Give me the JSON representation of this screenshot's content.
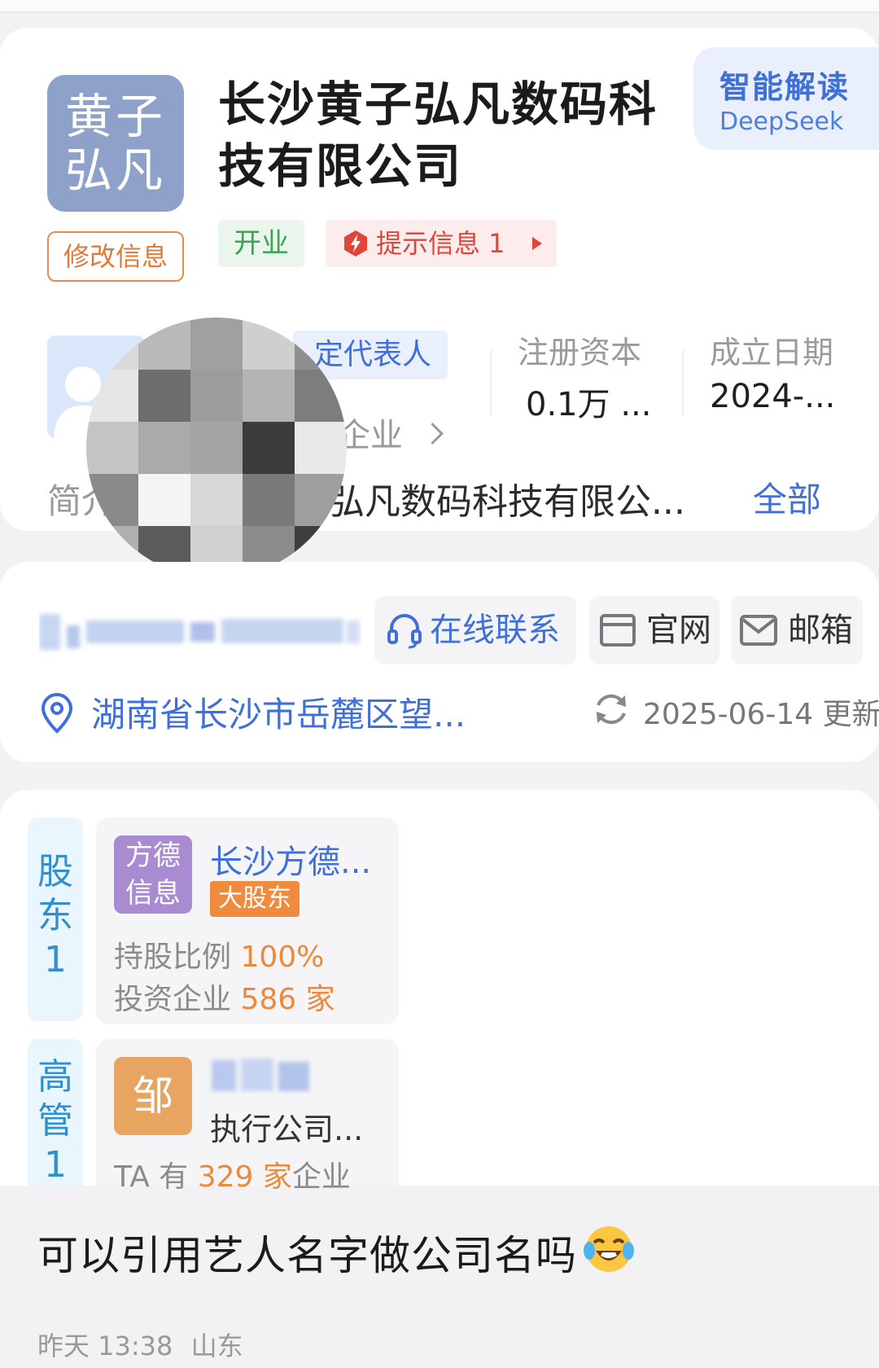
{
  "company": {
    "logo_line1": "黄子",
    "logo_line2": "弘凡",
    "edit_label": "修改信息",
    "name": "长沙黄子弘凡数码科技有限公司",
    "ai_title": "智能解读",
    "ai_sub": "DeepSeek",
    "status_tag": "开业",
    "tip_tag": "提示信息 1"
  },
  "overview": {
    "rep_label": "定代表人",
    "rep_company": "企业",
    "capital_label": "注册资本",
    "capital_value": "0.1万 ...",
    "date_label": "成立日期",
    "date_value": "2024-...",
    "intro_label": "简介",
    "intro_text": "弘凡数码科技有限公...",
    "intro_more": "全部"
  },
  "contact": {
    "online": "在线联系",
    "website": "官网",
    "email": "邮箱",
    "address": "湖南省长沙市岳麓区望...",
    "updated": "2025-06-14 更新"
  },
  "shareholders": {
    "tab": [
      "股",
      "东",
      "1"
    ],
    "logo_line1": "方德",
    "logo_line2": "信息",
    "name": "长沙方德...",
    "badge": "大股东",
    "ratio_label": "持股比例 ",
    "ratio_value": "100%",
    "invest_label": "投资企业 ",
    "invest_value": "586 家"
  },
  "executives": {
    "tab": [
      "高",
      "管",
      "1"
    ],
    "logo": "邹",
    "role": "执行公司...",
    "count_prefix": "TA 有 ",
    "count_value": "329 家",
    "count_suffix": "企业"
  },
  "post": {
    "text": "可以引用艺人名字做公司名吗",
    "emoji": "face-with-tears-of-joy",
    "time": "昨天 13:38",
    "location": "山东"
  },
  "colors": {
    "accent_blue": "#3f6fd8",
    "open_green": "#3aa557",
    "tip_red": "#e0453b",
    "orange": "#ea8a3a"
  }
}
